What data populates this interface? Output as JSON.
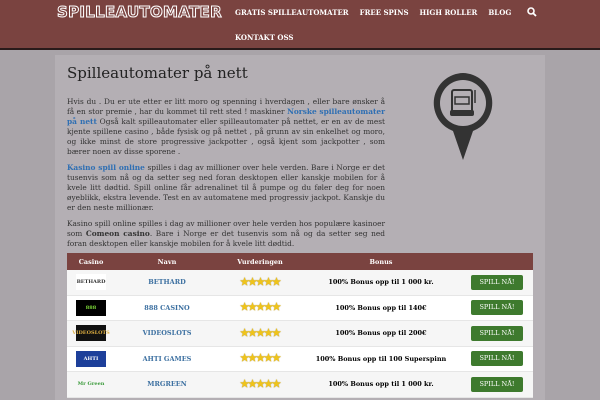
{
  "header": {
    "logo": "SPILLEAUTOMATER",
    "nav": [
      "GRATIS SPILLEAUTOMATER",
      "FREE SPINS",
      "HIGH ROLLER",
      "BLOG",
      "KONTAKT OSS"
    ]
  },
  "main": {
    "title": "Spilleautomater på nett",
    "p1a": "Hvis du . Du er ute etter er litt moro og spenning i hverdagen , eller bare ønsker å få en stor premie , har du kommet til rett sted ! maskiner ",
    "p1link": "Norske spilleautomater på nett",
    "p1b": " Også kalt spilleautomater eller spilleautomater på nettet, er en av de mest kjente spillene casino , både fysisk og på nettet , på grunn av sin enkelhet og moro, og ikke minst de store progressive jackpotter , også kjent som jackpotter , som bærer noen av disse sporene .",
    "p2link": "Kasino spill online",
    "p2b": " spilles i dag av millioner over hele verden. Bare i Norge er det tusenvis som nå og da setter seg ned foran desktopen eller kanskje mobilen for å kvele litt dødtid. Spill online får adrenalinet til å pumpe og du føler deg for noen øyeblikk, ekstra levende. Test en av automatene med progressiv jackpot. Kanskje du er den neste millionær.",
    "p3a": "Kasino spill online spilles i dag av millioner over hele verden hos populære kasinoer som ",
    "p3bold": "Comeon casino",
    "p3b": ". Bare i Norge er det tusenvis som nå og da setter seg ned foran desktopen eller kanskje mobilen for å kvele litt dødtid."
  },
  "table": {
    "headers": [
      "Casino",
      "Navn",
      "Vurderingen",
      "Bonus",
      ""
    ],
    "rows": [
      {
        "logo": "BETHARD",
        "name": "BETHARD",
        "stars": "★★★★★",
        "bonus": "100% Bonus opp til 1 000 kr.",
        "cta": "SPILL NÅ!"
      },
      {
        "logo": "888",
        "name": "888 CASINO",
        "stars": "★★★★★",
        "bonus": "100% Bonus opp til 140€",
        "cta": "SPILL NÅ!"
      },
      {
        "logo": "VIDEOSLOTS",
        "name": "VIDEOSLOTS",
        "stars": "★★★★★",
        "bonus": "100% Bonus opp til 200€",
        "cta": "SPILL NÅ!"
      },
      {
        "logo": "AHTI",
        "name": "AHTI GAMES",
        "stars": "★★★★★",
        "bonus": "100% Bonus opp til 100 Superspinn",
        "cta": "SPILL NÅ!"
      },
      {
        "logo": "Mr Green",
        "name": "MRGREEN",
        "stars": "★★★★★",
        "bonus": "100% Bonus opp til 1 000 kr.",
        "cta": "SPILL NÅ!"
      }
    ]
  },
  "colors": {
    "header": "#7a4340",
    "link": "#2f6fb3",
    "button": "#3e7a2e"
  }
}
